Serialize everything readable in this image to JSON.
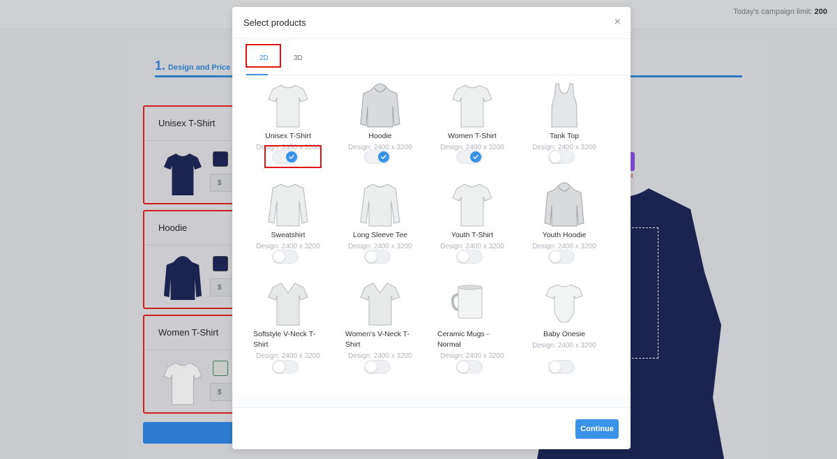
{
  "topbar": {
    "limit_label": "Today's campaign limit: ",
    "limit_value": "200"
  },
  "steps": {
    "step_number": "1.",
    "step_label": "Design and Price"
  },
  "side_products": [
    {
      "title": "Unisex T-Shirt",
      "currency": "$",
      "color": "#1b2450"
    },
    {
      "title": "Hoodie",
      "currency": "$",
      "color": "#1b2450"
    },
    {
      "title": "Women T-Shirt",
      "currency": "$",
      "color": "#c9cbc9"
    }
  ],
  "modal": {
    "title": "Select products",
    "close_icon": "close-icon",
    "tabs": [
      {
        "label": "2D",
        "active": true
      },
      {
        "label": "3D",
        "active": false
      }
    ],
    "products": [
      {
        "name": "Unisex T-Shirt",
        "design": "Design: 2400 x 3200",
        "selected": true,
        "icon": "tshirt"
      },
      {
        "name": "Hoodie",
        "design": "Design: 2400 x 3200",
        "selected": true,
        "icon": "hoodie"
      },
      {
        "name": "Women T-Shirt",
        "design": "Design: 2400 x 3200",
        "selected": true,
        "icon": "tshirt"
      },
      {
        "name": "Tank Top",
        "design": "Design: 2400 x 3200",
        "selected": false,
        "icon": "tank"
      },
      {
        "name": "Sweatshirt",
        "design": "Design: 2400 x 3200",
        "selected": false,
        "icon": "longsleeve"
      },
      {
        "name": "Long Sleeve Tee",
        "design": "Design: 2400 x 3200",
        "selected": false,
        "icon": "longsleeve"
      },
      {
        "name": "Youth T-Shirt",
        "design": "Design: 2400 x 3200",
        "selected": false,
        "icon": "tshirt"
      },
      {
        "name": "Youth Hoodie",
        "design": "Design: 2400 x 3200",
        "selected": false,
        "icon": "hoodie"
      },
      {
        "name": "Softstyle V-Neck T-Shirt",
        "design": "Design: 2400 x 3200",
        "selected": false,
        "icon": "vneck"
      },
      {
        "name": "Women's V-Neck T-Shirt",
        "design": "Design: 2400 x 3200",
        "selected": false,
        "icon": "vneck"
      },
      {
        "name": "Ceramic Mugs - Normal",
        "design": "Design: 2400 x 3200",
        "selected": false,
        "icon": "mug"
      },
      {
        "name": "Baby Onesie",
        "design": "Design: 2400 x 3200",
        "selected": false,
        "icon": "onesie"
      }
    ],
    "continue_label": "Continue"
  },
  "preview": {
    "partial_text": "nt"
  },
  "colors": {
    "accent": "#3a92e8",
    "highlight": "#e01414",
    "navy": "#1b2450"
  }
}
